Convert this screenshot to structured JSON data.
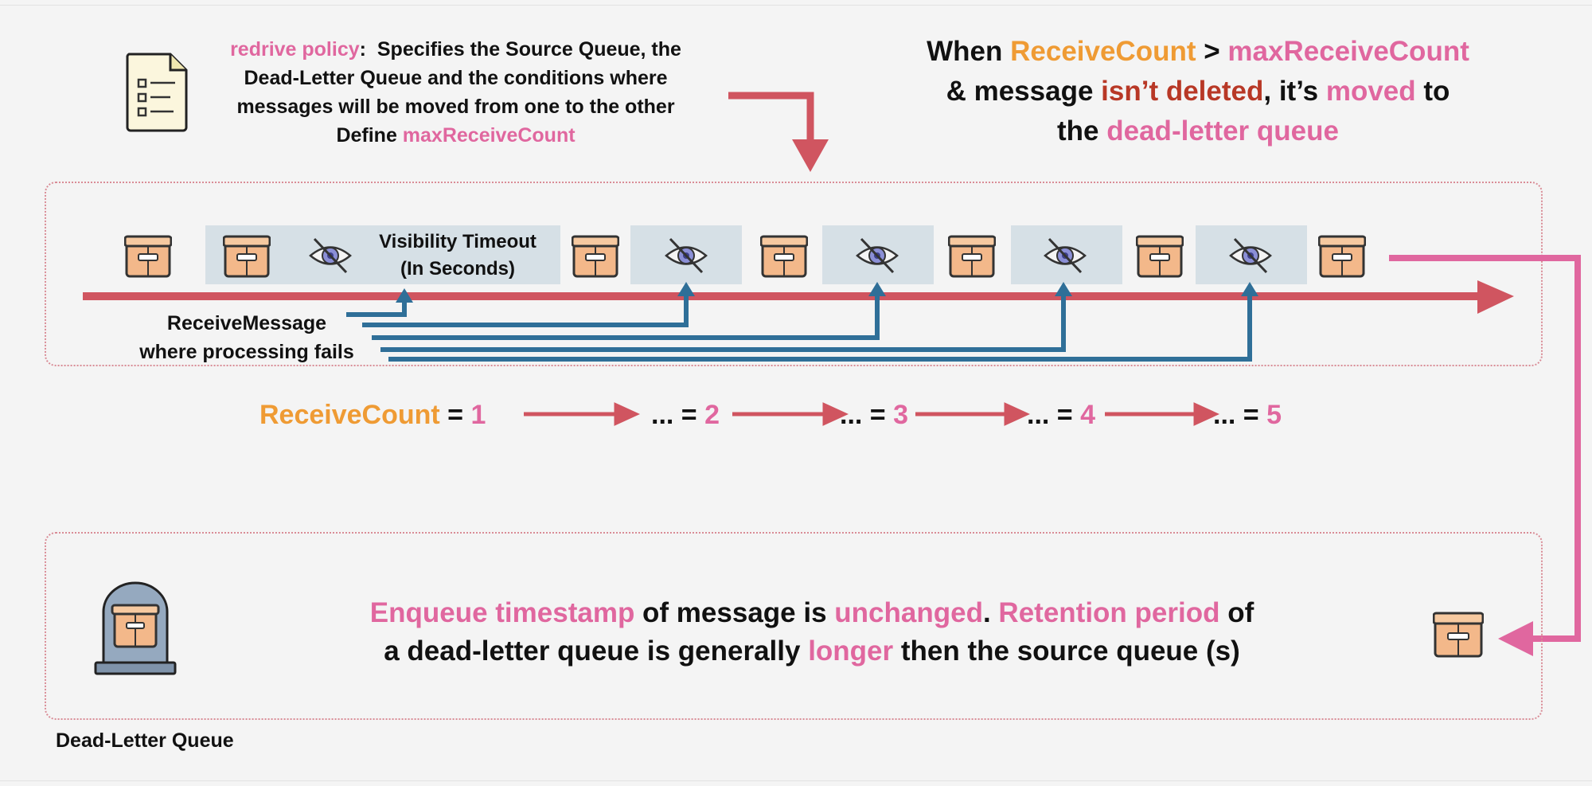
{
  "redrive": {
    "term": "redrive policy",
    "separator": ":",
    "line1_rest": "Specifies the Source Queue, the",
    "line2": "Dead-Letter Queue and the conditions where",
    "line3": "messages will be moved from one to the other",
    "line4_prefix": "Define ",
    "line4_term": "maxReceiveCount"
  },
  "when": {
    "w1": "When ",
    "receive_count": "ReceiveCount",
    "gt": " > ",
    "max_receive_count": "maxReceiveCount",
    "w2": "& message ",
    "isnt_deleted": "isn’t deleted",
    "w3": ", it’s ",
    "moved": "moved",
    "w4": " to",
    "w5": "the ",
    "dlq": "dead-letter queue"
  },
  "visibility": {
    "line1": "Visibility Timeout",
    "line2": "(In Seconds)"
  },
  "receive_message": {
    "line1": "ReceiveMessage",
    "line2": "where processing fails"
  },
  "counts": {
    "label": "ReceiveCount",
    "eq": " = ",
    "ellipsis": "... = ",
    "values": [
      "1",
      "2",
      "3",
      "4",
      "5"
    ]
  },
  "dlq_note": {
    "p1": "Enqueue timestamp",
    "p2": " of message is ",
    "p3": "unchanged",
    "p4": ". ",
    "p5": "Retention period",
    "p6": " of",
    "p7": "a dead-letter queue is generally ",
    "p8": "longer",
    "p9": " then the source queue (s)"
  },
  "dlq_label": "Dead-Letter Queue",
  "colors": {
    "pink": "#e0679f",
    "orange": "#ef9b34",
    "dark_red": "#b83826",
    "red_line": "#d05560",
    "blue_line": "#2f6f98",
    "panel": "#d6e0e6",
    "box_tan": "#f3b88a"
  },
  "icons": {
    "document": "document-checklist-icon",
    "message_box": "message-box-icon",
    "hidden": "eye-slash-icon",
    "dlq": "tombstone-icon"
  }
}
